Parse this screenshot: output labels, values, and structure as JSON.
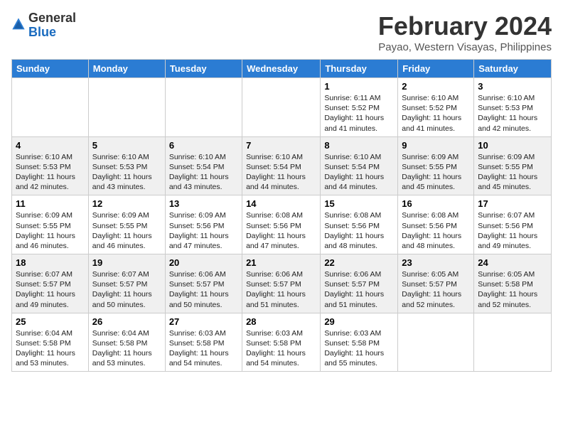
{
  "logo": {
    "text_general": "General",
    "text_blue": "Blue"
  },
  "title": "February 2024",
  "subtitle": "Payao, Western Visayas, Philippines",
  "days_header": [
    "Sunday",
    "Monday",
    "Tuesday",
    "Wednesday",
    "Thursday",
    "Friday",
    "Saturday"
  ],
  "weeks": [
    [
      {
        "day": "",
        "info": ""
      },
      {
        "day": "",
        "info": ""
      },
      {
        "day": "",
        "info": ""
      },
      {
        "day": "",
        "info": ""
      },
      {
        "day": "1",
        "info": "Sunrise: 6:11 AM\nSunset: 5:52 PM\nDaylight: 11 hours and 41 minutes."
      },
      {
        "day": "2",
        "info": "Sunrise: 6:10 AM\nSunset: 5:52 PM\nDaylight: 11 hours and 41 minutes."
      },
      {
        "day": "3",
        "info": "Sunrise: 6:10 AM\nSunset: 5:53 PM\nDaylight: 11 hours and 42 minutes."
      }
    ],
    [
      {
        "day": "4",
        "info": "Sunrise: 6:10 AM\nSunset: 5:53 PM\nDaylight: 11 hours and 42 minutes."
      },
      {
        "day": "5",
        "info": "Sunrise: 6:10 AM\nSunset: 5:53 PM\nDaylight: 11 hours and 43 minutes."
      },
      {
        "day": "6",
        "info": "Sunrise: 6:10 AM\nSunset: 5:54 PM\nDaylight: 11 hours and 43 minutes."
      },
      {
        "day": "7",
        "info": "Sunrise: 6:10 AM\nSunset: 5:54 PM\nDaylight: 11 hours and 44 minutes."
      },
      {
        "day": "8",
        "info": "Sunrise: 6:10 AM\nSunset: 5:54 PM\nDaylight: 11 hours and 44 minutes."
      },
      {
        "day": "9",
        "info": "Sunrise: 6:09 AM\nSunset: 5:55 PM\nDaylight: 11 hours and 45 minutes."
      },
      {
        "day": "10",
        "info": "Sunrise: 6:09 AM\nSunset: 5:55 PM\nDaylight: 11 hours and 45 minutes."
      }
    ],
    [
      {
        "day": "11",
        "info": "Sunrise: 6:09 AM\nSunset: 5:55 PM\nDaylight: 11 hours and 46 minutes."
      },
      {
        "day": "12",
        "info": "Sunrise: 6:09 AM\nSunset: 5:55 PM\nDaylight: 11 hours and 46 minutes."
      },
      {
        "day": "13",
        "info": "Sunrise: 6:09 AM\nSunset: 5:56 PM\nDaylight: 11 hours and 47 minutes."
      },
      {
        "day": "14",
        "info": "Sunrise: 6:08 AM\nSunset: 5:56 PM\nDaylight: 11 hours and 47 minutes."
      },
      {
        "day": "15",
        "info": "Sunrise: 6:08 AM\nSunset: 5:56 PM\nDaylight: 11 hours and 48 minutes."
      },
      {
        "day": "16",
        "info": "Sunrise: 6:08 AM\nSunset: 5:56 PM\nDaylight: 11 hours and 48 minutes."
      },
      {
        "day": "17",
        "info": "Sunrise: 6:07 AM\nSunset: 5:56 PM\nDaylight: 11 hours and 49 minutes."
      }
    ],
    [
      {
        "day": "18",
        "info": "Sunrise: 6:07 AM\nSunset: 5:57 PM\nDaylight: 11 hours and 49 minutes."
      },
      {
        "day": "19",
        "info": "Sunrise: 6:07 AM\nSunset: 5:57 PM\nDaylight: 11 hours and 50 minutes."
      },
      {
        "day": "20",
        "info": "Sunrise: 6:06 AM\nSunset: 5:57 PM\nDaylight: 11 hours and 50 minutes."
      },
      {
        "day": "21",
        "info": "Sunrise: 6:06 AM\nSunset: 5:57 PM\nDaylight: 11 hours and 51 minutes."
      },
      {
        "day": "22",
        "info": "Sunrise: 6:06 AM\nSunset: 5:57 PM\nDaylight: 11 hours and 51 minutes."
      },
      {
        "day": "23",
        "info": "Sunrise: 6:05 AM\nSunset: 5:57 PM\nDaylight: 11 hours and 52 minutes."
      },
      {
        "day": "24",
        "info": "Sunrise: 6:05 AM\nSunset: 5:58 PM\nDaylight: 11 hours and 52 minutes."
      }
    ],
    [
      {
        "day": "25",
        "info": "Sunrise: 6:04 AM\nSunset: 5:58 PM\nDaylight: 11 hours and 53 minutes."
      },
      {
        "day": "26",
        "info": "Sunrise: 6:04 AM\nSunset: 5:58 PM\nDaylight: 11 hours and 53 minutes."
      },
      {
        "day": "27",
        "info": "Sunrise: 6:03 AM\nSunset: 5:58 PM\nDaylight: 11 hours and 54 minutes."
      },
      {
        "day": "28",
        "info": "Sunrise: 6:03 AM\nSunset: 5:58 PM\nDaylight: 11 hours and 54 minutes."
      },
      {
        "day": "29",
        "info": "Sunrise: 6:03 AM\nSunset: 5:58 PM\nDaylight: 11 hours and 55 minutes."
      },
      {
        "day": "",
        "info": ""
      },
      {
        "day": "",
        "info": ""
      }
    ]
  ]
}
